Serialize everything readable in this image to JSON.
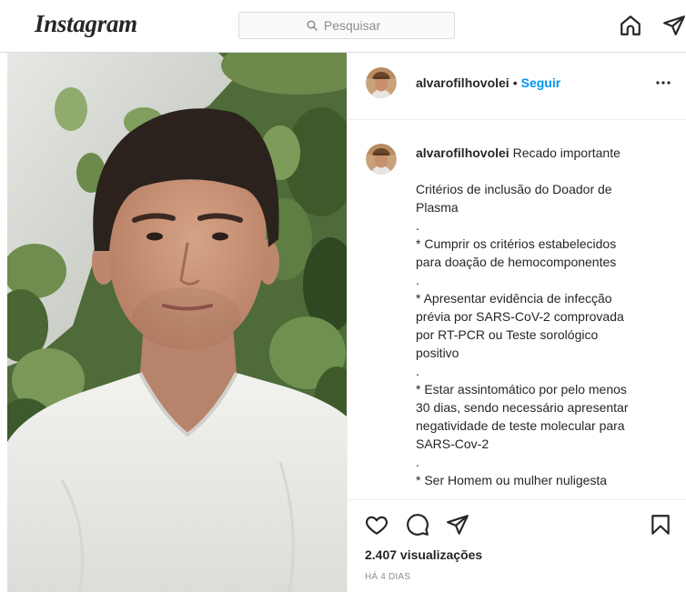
{
  "header": {
    "logo_text": "Instagram",
    "search": {
      "placeholder": "Pesquisar",
      "icon": "search-icon"
    },
    "nav": {
      "home_icon": "home-icon",
      "direct_icon": "direct-icon"
    }
  },
  "post": {
    "author": {
      "username": "alvarofilhovolei",
      "separator": "•",
      "follow_label": "Seguir",
      "more_icon": "more-options-icon"
    },
    "caption": {
      "username": "alvarofilhovolei",
      "title": "Recado importante",
      "lines": [
        "Critérios de inclusão do Doador de",
        "Plasma",
        ".",
        "* Cumprir os critérios estabelecidos",
        "para doação de hemocomponentes",
        ".",
        "* Apresentar evidência de infecção",
        "prévia por SARS-CoV-2 comprovada",
        "por RT-PCR ou Teste sorológico",
        "positivo",
        ".",
        "* Estar assintomático por pelo menos",
        "30 dias, sendo necessário apresentar",
        "negatividade de teste molecular para",
        "SARS-Cov-2",
        ".",
        "* Ser Homem ou mulher nuligesta"
      ]
    },
    "actions": {
      "like_icon": "heart-icon",
      "comment_icon": "comment-icon",
      "share_icon": "share-icon",
      "save_icon": "bookmark-icon"
    },
    "views": "2.407 visualizações",
    "timestamp": "HÁ 4 DIAS"
  },
  "colors": {
    "text": "#262626",
    "secondary_text": "#8e8e8e",
    "accent": "#0095f6",
    "border": "#dbdbdb"
  }
}
